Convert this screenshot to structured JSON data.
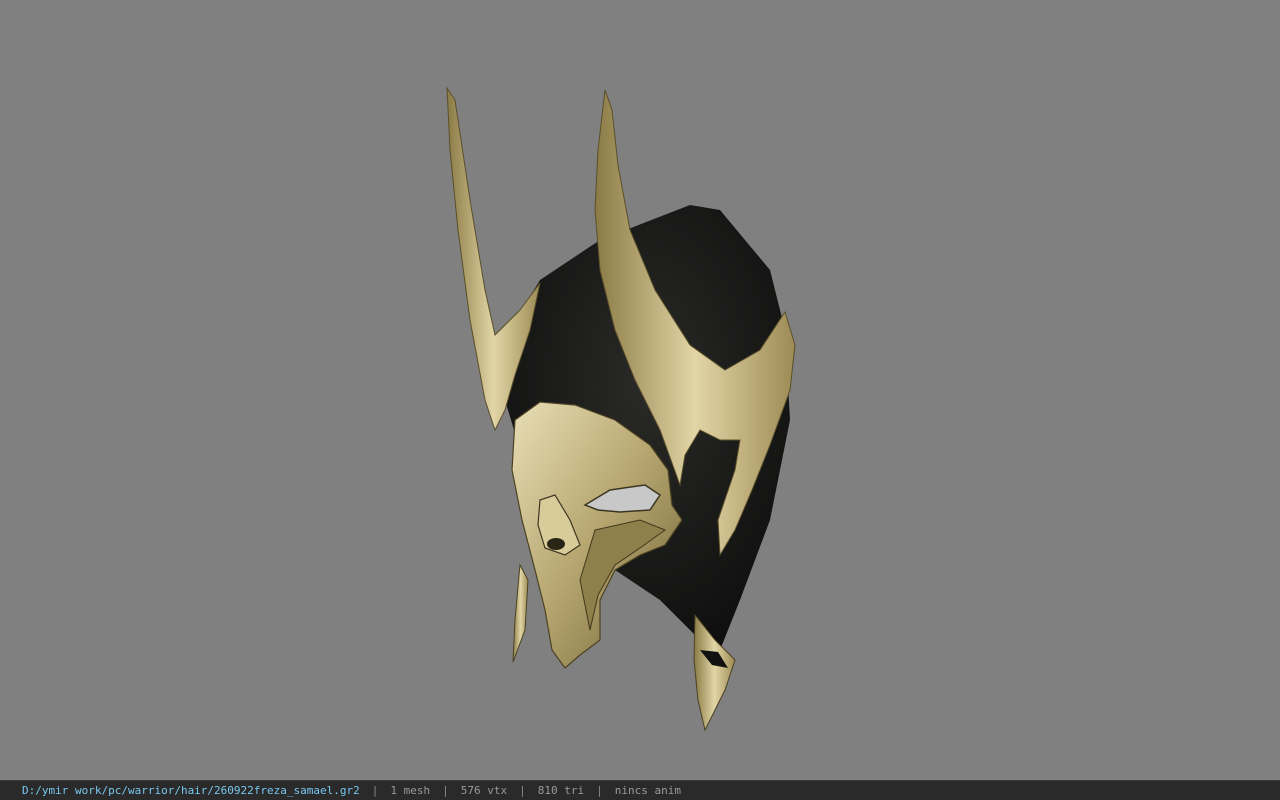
{
  "viewport": {
    "background": "#808080",
    "model_icon": "samael-helmet-3d-model"
  },
  "statusbar": {
    "file_path": "D:/ymir work/pc/warrior/hair/260922freza_samael.gr2",
    "separator": "|",
    "mesh_count": "1 mesh",
    "vertex_count": "576 vtx",
    "triangle_count": "810 tri",
    "anim_status": "nincs anim"
  }
}
